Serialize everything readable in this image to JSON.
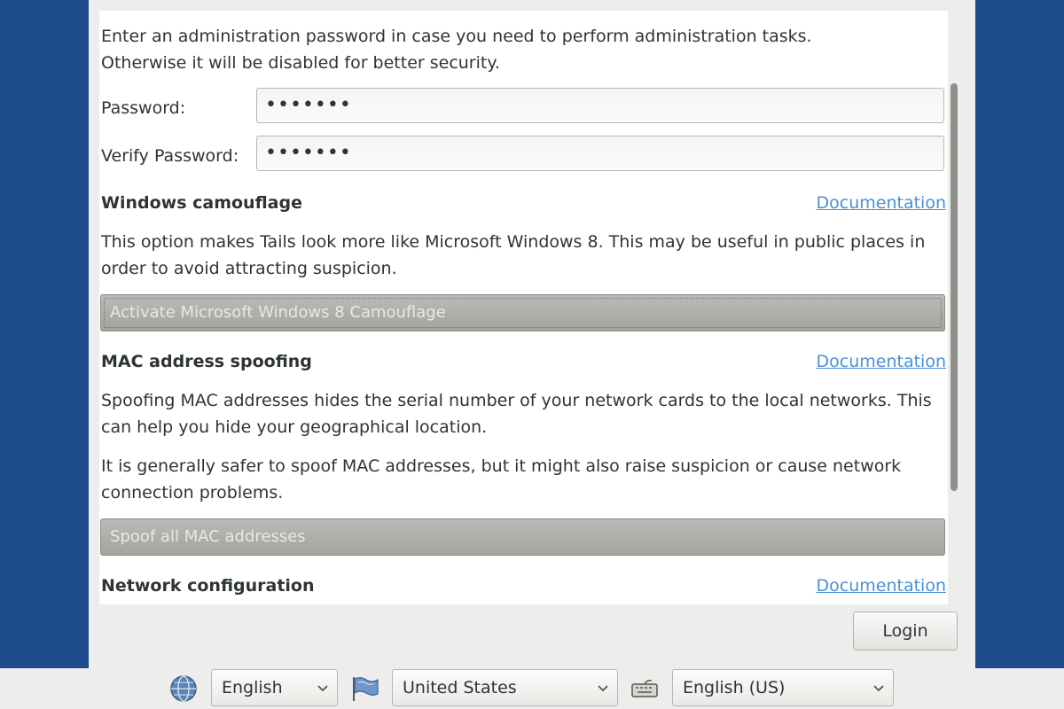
{
  "admin": {
    "intro_line1": "Enter an administration password in case you need to perform administration tasks.",
    "intro_line2": "Otherwise it will be disabled for better security.",
    "password_label": "Password:",
    "password_value": "•••••••",
    "verify_label": "Verify Password:",
    "verify_value": "•••••••"
  },
  "camouflage": {
    "heading": "Windows camouflage",
    "doc_link": "Documentation",
    "desc_line1": "This option makes Tails look more like Microsoft Windows 8. This may be useful in public places in",
    "desc_line2": "order to avoid attracting suspicion.",
    "toggle_label": "Activate Microsoft Windows 8 Camouflage"
  },
  "mac": {
    "heading": "MAC address spoofing",
    "doc_link": "Documentation",
    "desc1_line1": "Spoofing MAC addresses hides the serial number of your network cards to the local networks. This",
    "desc1_line2": "can help you hide your geographical location.",
    "desc2_line1": "It is generally safer to spoof MAC addresses, but it might also raise suspicion or cause network",
    "desc2_line2": "connection problems.",
    "toggle_label": "Spoof all MAC addresses"
  },
  "network": {
    "heading": "Network configuration",
    "doc_link": "Documentation"
  },
  "login_label": "Login",
  "bottom": {
    "language": "English",
    "country": "United States",
    "keyboard": "English (US)",
    "icons": [
      "globe-icon",
      "flag-icon",
      "keyboard-icon"
    ]
  },
  "colors": {
    "desktop": "#1d4a8a",
    "link": "#4a90d9",
    "toggle": "#a2a49f"
  }
}
